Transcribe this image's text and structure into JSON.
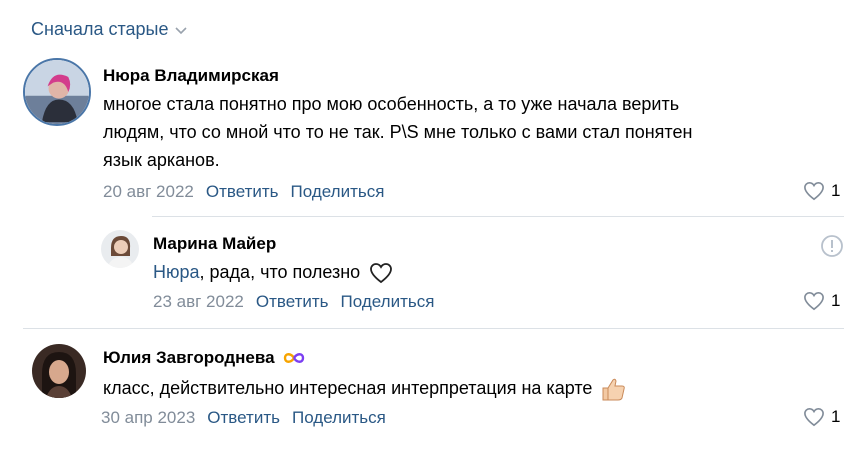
{
  "sort": {
    "label": "Сначала старые"
  },
  "comments": [
    {
      "author": "Нюра Владимирская",
      "lines": [
        "многое стала понятно про мою особенность, а то уже начала верить",
        "людям, что со мной что то не так. P\\S мне только с вами стал понятен",
        "язык арканов."
      ],
      "date": "20 авг 2022",
      "reply_label": "Ответить",
      "share_label": "Поделиться",
      "likes": "1"
    },
    {
      "author": "Марина Майер",
      "mention": "Нюра",
      "text": ", рада, что полезно",
      "date": "23 авг 2022",
      "reply_label": "Ответить",
      "share_label": "Поделиться",
      "likes": "1"
    },
    {
      "author": "Юлия Завгороднева",
      "text": "класс, действительно интересная интерпретация на карте",
      "date": "30 апр 2023",
      "reply_label": "Ответить",
      "share_label": "Поделиться",
      "likes": "1"
    }
  ],
  "colors": {
    "link": "#2a5885",
    "muted": "#818c99",
    "divider": "#dce1e6",
    "badge_orange": "#f7a400",
    "badge_purple": "#7b3ff2"
  },
  "icons": [
    "chevron-down-icon",
    "heart-icon",
    "report-icon",
    "infinity-badge-icon",
    "thumbs-up-emoji"
  ]
}
